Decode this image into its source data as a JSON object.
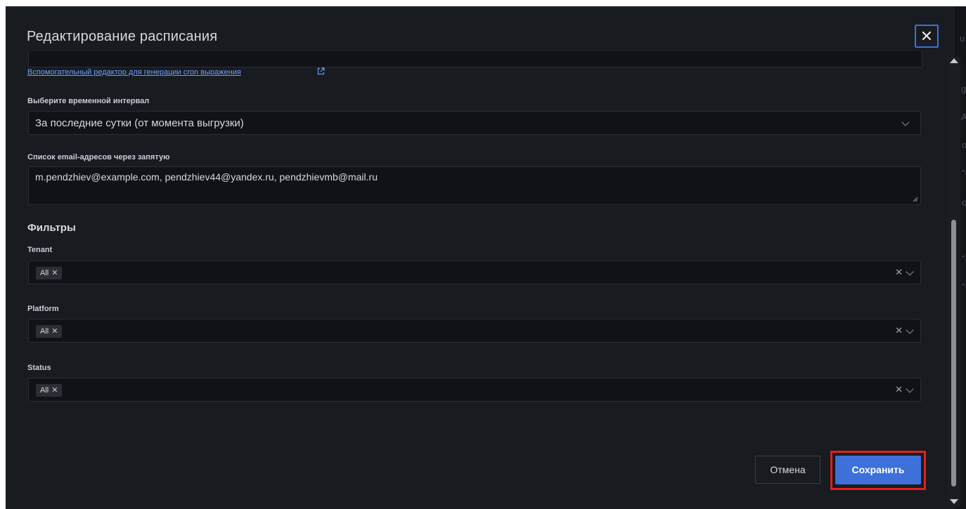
{
  "modal": {
    "title": "Редактирование расписания",
    "close_icon": "close-icon"
  },
  "cron_helper": {
    "link_text": "Вспомогательный редактор для генерации cron выражения",
    "icon": "external-link-icon"
  },
  "interval": {
    "label": "Выберите временной интервал",
    "value": "За последние сутки (от момента выгрузки)"
  },
  "emails": {
    "label": "Список email-адресов через запятую",
    "value": "m.pendzhiev@example.com, pendzhiev44@yandex.ru, pendzhievmb@mail.ru"
  },
  "filters": {
    "title": "Фильтры",
    "items": [
      {
        "label": "Tenant",
        "chips": [
          "All"
        ]
      },
      {
        "label": "Platform",
        "chips": [
          "All"
        ]
      },
      {
        "label": "Status",
        "chips": [
          "All"
        ]
      }
    ]
  },
  "buttons": {
    "cancel": "Отмена",
    "save": "Сохранить"
  },
  "colors": {
    "primary": "#3d71d9",
    "highlight": "#e0201e",
    "link": "#6e9fff",
    "modal_bg": "#181b1f",
    "input_bg": "#111217"
  }
}
